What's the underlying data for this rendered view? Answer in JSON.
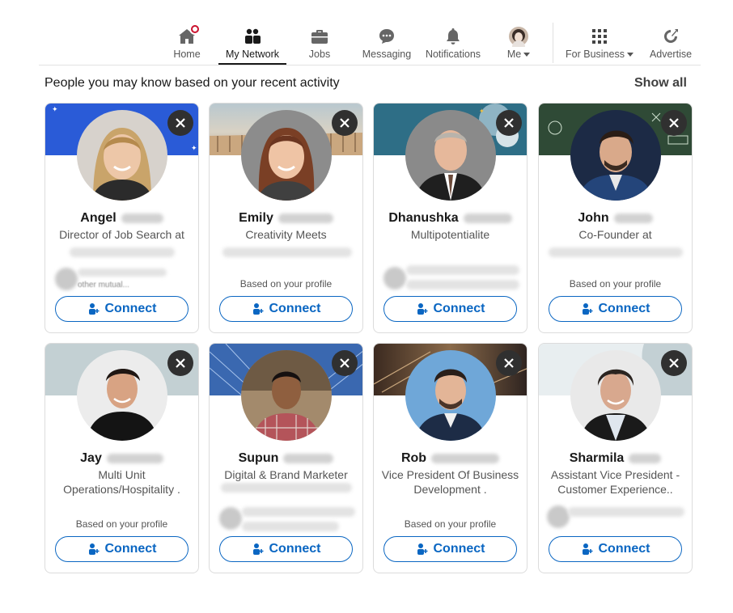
{
  "nav": {
    "home": "Home",
    "my_network": "My Network",
    "jobs": "Jobs",
    "messaging": "Messaging",
    "notifications": "Notifications",
    "me": "Me",
    "for_business": "For Business",
    "advertise": "Advertise"
  },
  "section": {
    "title": "People you may know based on your recent activity",
    "show_all": "Show all"
  },
  "cards": [
    {
      "name": "Angel",
      "title": "Director of Job Search at",
      "reason": "",
      "faded": "other mutual...",
      "connect": "Connect"
    },
    {
      "name": "Emily",
      "title": "Creativity Meets",
      "reason": "Based on your profile",
      "faded": "",
      "connect": "Connect"
    },
    {
      "name": "Dhanushka",
      "title": "Multipotentialite",
      "reason": "",
      "faded": "",
      "connect": "Connect"
    },
    {
      "name": "John",
      "title": "Co-Founder at",
      "reason": "Based on your profile",
      "faded": "",
      "connect": "Connect"
    },
    {
      "name": "Jay",
      "title": "Multi Unit Operations/Hospitality .",
      "reason": "Based on your profile",
      "faded": "",
      "connect": "Connect"
    },
    {
      "name": "Supun",
      "title": "Digital & Brand Marketer",
      "reason": "",
      "faded": "",
      "connect": "Connect"
    },
    {
      "name": "Rob",
      "title": "Vice President Of Business Development .",
      "reason": "Based on your profile",
      "faded": "",
      "connect": "Connect"
    },
    {
      "name": "Sharmila",
      "title": "Assistant Vice President - Customer Experience..",
      "reason": "",
      "faded": "",
      "connect": "Connect"
    }
  ],
  "colors": {
    "brand_blue": "#0a66c2",
    "notification_red": "#cb112d",
    "dismiss_bg": "#303030"
  },
  "icons": {
    "home": "home-icon",
    "my_network": "people-icon",
    "jobs": "briefcase-icon",
    "messaging": "chat-icon",
    "notifications": "bell-icon",
    "for_business": "grid-icon",
    "advertise": "compass-icon",
    "dismiss": "close-icon",
    "connect": "add-person-icon"
  }
}
